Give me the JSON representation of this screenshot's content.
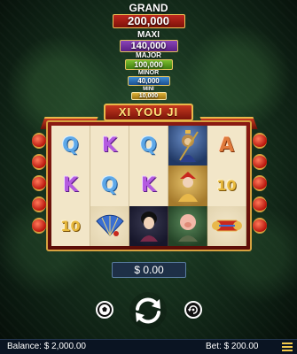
{
  "jackpots": {
    "grand": {
      "label": "GRAND",
      "value": "200,000"
    },
    "maxi": {
      "label": "MAXI",
      "value": "140,000"
    },
    "major": {
      "label": "MAJOR",
      "value": "100,000"
    },
    "minor": {
      "label": "MINOR",
      "value": "40,000"
    },
    "mini": {
      "label": "MINI",
      "value": "10,000"
    }
  },
  "game": {
    "title": "XI YOU JI"
  },
  "reels": [
    [
      {
        "sym": "Q"
      },
      {
        "sym": "K"
      },
      {
        "sym": "10"
      }
    ],
    [
      {
        "sym": "K"
      },
      {
        "sym": "Q"
      },
      {
        "sym": "fan"
      }
    ],
    [
      {
        "sym": "Q"
      },
      {
        "sym": "K"
      },
      {
        "sym": "lady"
      }
    ],
    [
      {
        "sym": "monkey"
      },
      {
        "sym": "monk"
      },
      {
        "sym": "pig"
      }
    ],
    [
      {
        "sym": "A"
      },
      {
        "sym": "10"
      },
      {
        "sym": "scroll"
      }
    ]
  ],
  "win": {
    "value": "$ 0.00"
  },
  "controls": {
    "autoplay_icon": "soccer-ball-icon",
    "spin_icon": "refresh-icon",
    "turbo_icon": "rotate-icon"
  },
  "footer": {
    "balance": "Balance: $ 2,000.00",
    "bet": "Bet: $ 200.00",
    "menu_icon": "hamburger-icon"
  }
}
